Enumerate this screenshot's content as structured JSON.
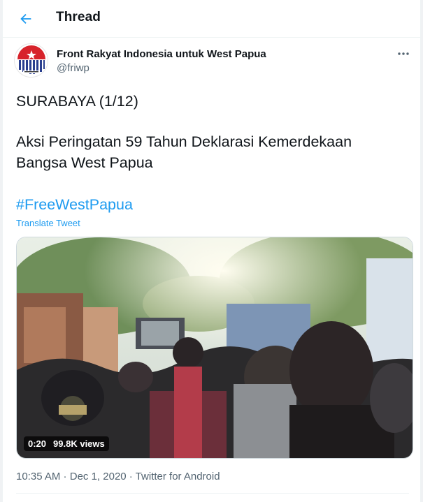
{
  "header": {
    "back_icon": "arrow-left-icon",
    "title": "Thread"
  },
  "author": {
    "name": "Front Rakyat Indonesia untuk West Papua",
    "handle": "@friwp",
    "more_icon": "more-horizontal-icon"
  },
  "tweet": {
    "line1": "SURABAYA (1/12)",
    "line2": "Aksi Peringatan 59 Tahun Deklarasi Kemerdekaan",
    "line3": "Bangsa West Papua",
    "hashtag": "#FreeWestPapua",
    "translate_label": "Translate Tweet"
  },
  "video": {
    "duration": "0:20",
    "views": "99.8K views"
  },
  "meta": {
    "time": "10:35 AM",
    "sep1": " · ",
    "date": "Dec 1, 2020",
    "sep2": " · ",
    "source": "Twitter for Android"
  },
  "colors": {
    "accent": "#1d9bf0",
    "secondary_text": "#536471"
  }
}
